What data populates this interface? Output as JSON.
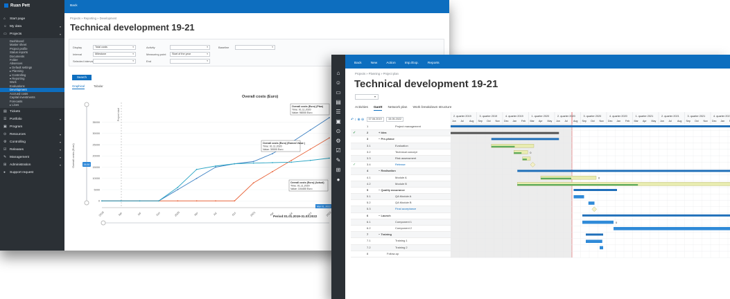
{
  "back": {
    "logo": "Ruan Pett",
    "topbar": "Back",
    "breadcrumb": "Projects  »  Reporting  »  Development",
    "title": "Technical development 19-21",
    "sidebar": [
      {
        "icon": "⌂",
        "label": "Start page",
        "arrow": ""
      },
      {
        "icon": "☺",
        "label": "My data",
        "arrow": "▾"
      },
      {
        "icon": "▭",
        "label": "Projects",
        "arrow": "▾"
      }
    ],
    "sidebar_sub": [
      "Dashboard",
      "Master sheet",
      "Project profile",
      "Status reports",
      "Documents",
      "Folder",
      "Absences",
      "▸ Default settings",
      "▸ Planning",
      "▸ Controlling",
      "▾ Reporting",
      "Work",
      "Evaluations",
      "Development",
      "Accrued costs",
      "Capital investments",
      "Forecasts",
      "▸ Lines"
    ],
    "sidebar_sub_active": 13,
    "sidebar2": [
      {
        "icon": "▤",
        "label": "Tickets",
        "arrow": ""
      },
      {
        "icon": "☰",
        "label": "Portfolio",
        "arrow": "▾"
      },
      {
        "icon": "▣",
        "label": "Program",
        "arrow": ""
      },
      {
        "icon": "⊙",
        "label": "Resources",
        "arrow": "▾"
      },
      {
        "icon": "⚙",
        "label": "Controlling",
        "arrow": "▾"
      },
      {
        "icon": "☑",
        "label": "Releases",
        "arrow": "▾"
      },
      {
        "icon": "✎",
        "label": "Management",
        "arrow": "▾"
      },
      {
        "icon": "⊞",
        "label": "Administration",
        "arrow": "▾"
      },
      {
        "icon": "●",
        "label": "Support request",
        "arrow": ""
      }
    ],
    "filters": {
      "display_label": "Display",
      "display_value": "Total costs",
      "interval_label": "Interval",
      "interval_value": "Milestone",
      "selected_label": "Selected interval",
      "activity_label": "Activity",
      "measuring_label": "Measuring point",
      "measuring_value": "Start of the year",
      "end_label": "End",
      "baseline_label": "Baseline"
    },
    "search_button": "Search",
    "tabs": [
      "Graphical",
      "Tabular"
    ]
  },
  "chart_data": {
    "type": "line",
    "title": "Overall costs (Euro)",
    "ylabel": "Overall costs (Euro)",
    "project_start_label": "Project start",
    "slider_value": "26.50",
    "period_label": "Period:01.01.2019-31.03.2022",
    "end_tag": "Mar 01, 2022",
    "ylim": [
      -3000,
      37000
    ],
    "yticks": [
      {
        "label": "35000",
        "v": 35000
      },
      {
        "label": "30000",
        "v": 30000
      },
      {
        "label": "25000",
        "v": 25000
      },
      {
        "label": "20000",
        "v": 20000
      },
      {
        "label": "15000",
        "v": 15000
      },
      {
        "label": "10000",
        "v": 10000
      },
      {
        "label": "5000",
        "v": 5000
      },
      {
        "label": "0",
        "v": 0
      }
    ],
    "categories": [
      "2019",
      "Apr",
      "Jul",
      "Oct",
      "2020",
      "Apr",
      "Jul",
      "Oct",
      "2021",
      "Apr",
      "Jul",
      "Oct",
      "2022"
    ],
    "series": [
      {
        "name": "Overall costs (Euro) (Plan)",
        "color": "#3a7fc2",
        "values": [
          0,
          0,
          0,
          0,
          5000,
          10000,
          15000,
          16500,
          17500,
          21000,
          26000,
          31500,
          37000
        ]
      },
      {
        "name": "Overall costs (Euro) (Earned Value)",
        "color": "#e8643a",
        "values": [
          0,
          0,
          0,
          0,
          0,
          0,
          0,
          0,
          8000,
          13000,
          18000,
          23000,
          28000
        ]
      },
      {
        "name": "Overall costs (Euro) (Actual)",
        "color": "#2aa5c4",
        "values": [
          0,
          0,
          0,
          0,
          6000,
          14000,
          15500,
          16500,
          16800,
          17000,
          17200,
          18000,
          19000
        ]
      }
    ],
    "tooltips": [
      {
        "title": "Overall costs (Euro) (Plan)",
        "time": "Time: 01.11.2020",
        "value": "Value: 98000 Euro"
      },
      {
        "title": "Overall costs (Euro) (Earned Value )",
        "time": "Time: 01.11.2020",
        "value": "Value: 30000 Euro"
      },
      {
        "title": "Overall costs (Euro) (Actual)",
        "time": "Time: 01.11.2020",
        "value": "Value: 104450 Euro"
      }
    ]
  },
  "front": {
    "menu": [
      "Back",
      "New",
      "Action",
      "Imp./Exp.",
      "Reports"
    ],
    "breadcrumb": "Projects  »  Planning  »  Project plan",
    "title": "Technical development 19-21",
    "select_chevron": "▾",
    "tabs": [
      "Activities",
      "Gantt",
      "Network plan",
      "Work breakdown structure"
    ],
    "toolbar_icons": "↶ ↕ ⊕ ⊖",
    "date_from": "07.06.2019",
    "date_to": "15.05.2022",
    "sidebar_icons": [
      "⌂",
      "☺",
      "▭",
      "▤",
      "☰",
      "▣",
      "⊙",
      "⚙",
      "☑",
      "✎",
      "⊞",
      "●"
    ],
    "tasks": [
      {
        "check": "",
        "num": "1",
        "name": "Project management",
        "level": 2,
        "group": false
      },
      {
        "check": "✓",
        "num": "2",
        "name": "+  Idea",
        "level": 0,
        "group": true
      },
      {
        "check": "",
        "num": "3",
        "name": "−  Pre-phase",
        "level": 0,
        "group": true
      },
      {
        "check": "",
        "num": "3.1",
        "name": "Evaluation",
        "level": 2,
        "group": false
      },
      {
        "check": "",
        "num": "3.2",
        "name": "Technical concept",
        "level": 2,
        "group": false
      },
      {
        "check": "",
        "num": "3.3",
        "name": "Risk assessment",
        "level": 2,
        "group": false
      },
      {
        "check": "✓",
        "num": "3.4",
        "name": "Release",
        "level": 2,
        "group": false,
        "link": true
      },
      {
        "check": "",
        "num": "4",
        "name": "−  Realisation",
        "level": 0,
        "group": true
      },
      {
        "check": "",
        "num": "4.1",
        "name": "Module A",
        "level": 2,
        "group": false
      },
      {
        "check": "",
        "num": "4.2",
        "name": "Module B",
        "level": 2,
        "group": false
      },
      {
        "check": "",
        "num": "5",
        "name": "−  Quality assurance",
        "level": 0,
        "group": true
      },
      {
        "check": "",
        "num": "5.1",
        "name": "QA Module A",
        "level": 2,
        "group": false
      },
      {
        "check": "",
        "num": "5.2",
        "name": "QA Module B",
        "level": 2,
        "group": false
      },
      {
        "check": "",
        "num": "5.3",
        "name": "Final acceptance",
        "level": 2,
        "group": false,
        "link": true
      },
      {
        "check": "",
        "num": "6",
        "name": "−  Launch",
        "level": 0,
        "group": true
      },
      {
        "check": "",
        "num": "6.1",
        "name": "Component 1",
        "level": 2,
        "group": false
      },
      {
        "check": "",
        "num": "6.2",
        "name": "Component 2",
        "level": 2,
        "group": false
      },
      {
        "check": "",
        "num": "7",
        "name": "−  Training",
        "level": 0,
        "group": true
      },
      {
        "check": "",
        "num": "7.1",
        "name": "Training 1",
        "level": 2,
        "group": false
      },
      {
        "check": "",
        "num": "7.2",
        "name": "Training 2",
        "level": 2,
        "group": false
      },
      {
        "check": "",
        "num": "8",
        "name": "Follow-up",
        "level": 1,
        "group": false
      }
    ],
    "quarters": [
      "2. quarter 2019",
      "3. quarter 2019",
      "4. quarter 2019",
      "1. quarter 2020",
      "2. quarter 2020",
      "3. quarter 2020",
      "4. quarter 2020",
      "1. quarter 2021",
      "2. quarter 2021",
      "3. quarter 2021",
      "4. quarter 2021",
      "1. qua"
    ],
    "months": [
      "Jun",
      "Jul",
      "Aug",
      "Sep",
      "Oct",
      "Nov",
      "Dec",
      "Jan",
      "Feb",
      "Mar",
      "Apr",
      "May",
      "Jun",
      "Jul",
      "Aug",
      "Sep",
      "Oct",
      "Nov",
      "Dec",
      "Jan",
      "Feb",
      "Mar",
      "Apr",
      "May",
      "Jun",
      "Jul",
      "Aug",
      "Sep",
      "Oct",
      "Nov",
      "Dec",
      "Jan",
      "Feb"
    ],
    "bars": [
      {
        "row": 0,
        "start": 0,
        "end": 33,
        "kind": "summary"
      },
      {
        "row": 1,
        "start": 0,
        "end": 12.5,
        "kind": "dark"
      },
      {
        "row": 2,
        "start": 4.7,
        "end": 12.5,
        "kind": "summary"
      },
      {
        "row": 3,
        "start": 4.7,
        "end": 9.6,
        "kind": "task"
      },
      {
        "row": 4,
        "start": 7.3,
        "end": 8.9,
        "kind": "task"
      },
      {
        "row": 5,
        "start": 8.3,
        "end": 9.2,
        "kind": "task"
      },
      {
        "row": 6,
        "start": 9.2,
        "end": 9.6,
        "kind": "milestone"
      },
      {
        "row": 7,
        "start": 7.7,
        "end": 33,
        "kind": "summary"
      },
      {
        "row": 8,
        "start": 10.4,
        "end": 16.8,
        "kind": "task"
      },
      {
        "row": 9,
        "start": 7.7,
        "end": 33,
        "kind": "task"
      },
      {
        "row": 10,
        "start": 14.2,
        "end": 19.2,
        "kind": "summary"
      },
      {
        "row": 11,
        "start": 14.2,
        "end": 15.4,
        "kind": "blue"
      },
      {
        "row": 12,
        "start": 15.9,
        "end": 16.6,
        "kind": "blue"
      },
      {
        "row": 13,
        "start": 16.3,
        "end": 16.8,
        "kind": "milestone"
      },
      {
        "row": 14,
        "start": 15.2,
        "end": 33,
        "kind": "summary"
      },
      {
        "row": 15,
        "start": 15.2,
        "end": 18.8,
        "kind": "blue"
      },
      {
        "row": 16,
        "start": 18.8,
        "end": 33,
        "kind": "blue"
      },
      {
        "row": 17,
        "start": 15.6,
        "end": 17.6,
        "kind": "summary"
      },
      {
        "row": 18,
        "start": 15.6,
        "end": 17.5,
        "kind": "blue"
      },
      {
        "row": 19,
        "start": 17.2,
        "end": 17.6,
        "kind": "blue"
      }
    ],
    "zero_labels": [
      {
        "row": 4,
        "text": "0",
        "at": 8.9
      },
      {
        "row": 8,
        "text": "0",
        "at": 16.8
      },
      {
        "row": 15,
        "text": "0",
        "at": 18.8
      }
    ]
  }
}
